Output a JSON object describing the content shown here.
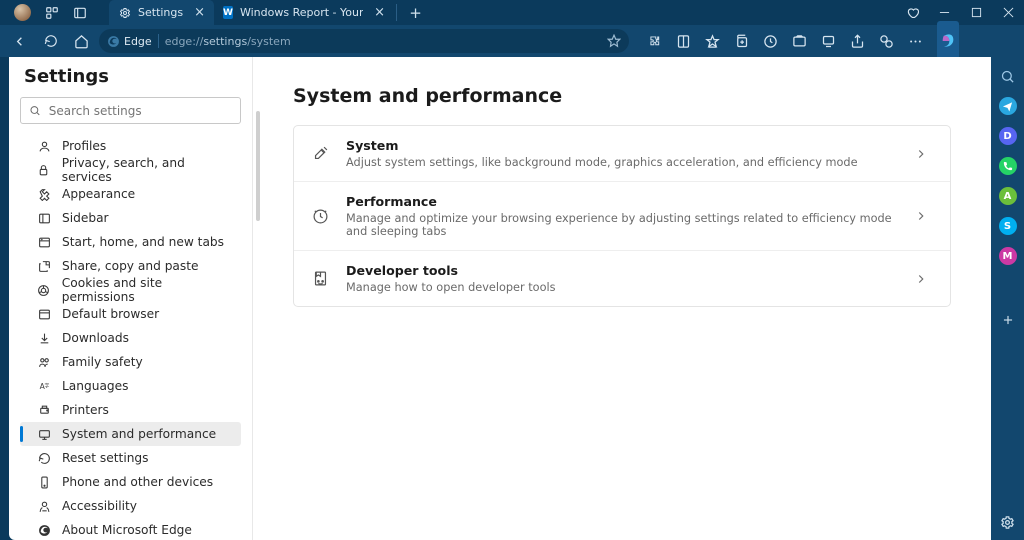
{
  "titlebar": {
    "tabs": [
      {
        "title": "Settings"
      },
      {
        "title": "Windows Report - Your go-to sou..."
      }
    ]
  },
  "address": {
    "badge": "Edge",
    "url_prefix": "edge://",
    "url_bold": "settings",
    "url_rest": "/system"
  },
  "sidebar": {
    "heading": "Settings",
    "search_placeholder": "Search settings",
    "items": [
      "Profiles",
      "Privacy, search, and services",
      "Appearance",
      "Sidebar",
      "Start, home, and new tabs",
      "Share, copy and paste",
      "Cookies and site permissions",
      "Default browser",
      "Downloads",
      "Family safety",
      "Languages",
      "Printers",
      "System and performance",
      "Reset settings",
      "Phone and other devices",
      "Accessibility",
      "About Microsoft Edge"
    ],
    "active_index": 12
  },
  "content": {
    "heading": "System and performance",
    "rows": [
      {
        "title": "System",
        "subtitle": "Adjust system settings, like background mode, graphics acceleration, and efficiency mode"
      },
      {
        "title": "Performance",
        "subtitle": "Manage and optimize your browsing experience by adjusting settings related to efficiency mode and sleeping tabs"
      },
      {
        "title": "Developer tools",
        "subtitle": "Manage how to open developer tools"
      }
    ]
  },
  "rightrail": {
    "items": [
      {
        "name": "search-icon",
        "color": "#9ec8e6",
        "glyph": "search"
      },
      {
        "name": "telegram-icon",
        "color": "#2aa7e0",
        "glyph": "plane"
      },
      {
        "name": "discord-icon",
        "color": "#5765f2",
        "glyph": "discord"
      },
      {
        "name": "whatsapp-icon",
        "color": "#25d366",
        "glyph": "phone"
      },
      {
        "name": "android-icon",
        "color": "#6bbf3b",
        "glyph": "android"
      },
      {
        "name": "skype-icon",
        "color": "#00aff0",
        "glyph": "s"
      },
      {
        "name": "messenger-icon",
        "color": "#cc39a4",
        "glyph": "m"
      }
    ]
  }
}
